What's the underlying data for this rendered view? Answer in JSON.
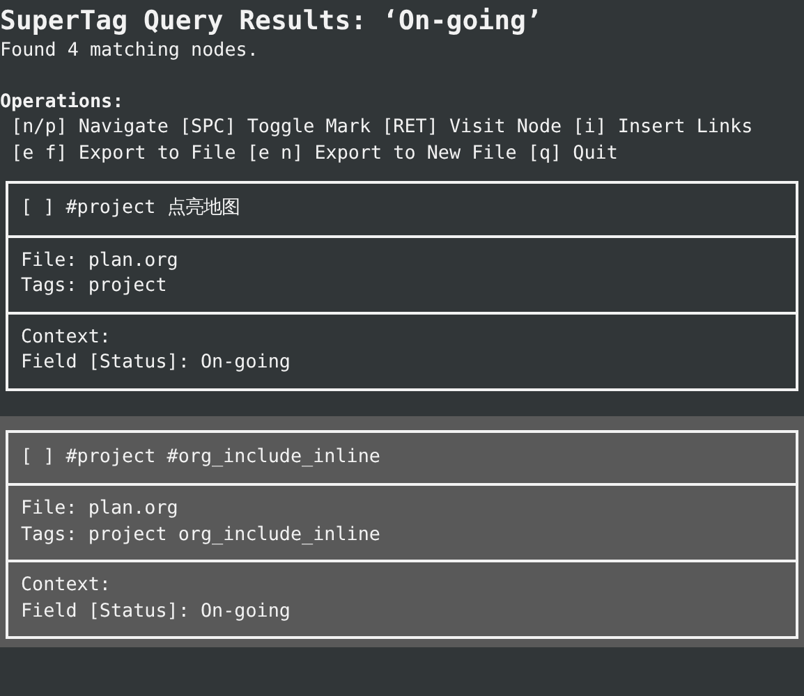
{
  "title": "SuperTag Query Results: ‘On-going’",
  "summary": "Found 4 matching nodes.",
  "operations": {
    "heading": "Operations:",
    "lines": [
      " [n/p] Navigate [SPC] Toggle Mark [RET] Visit Node [i] Insert Links",
      " [e f] Export to File [e n] Export to New File [q] Quit"
    ]
  },
  "nodes": [
    {
      "selected": false,
      "header": "[ ] #project 点亮地图",
      "file": "File: plan.org",
      "tags": "Tags: project",
      "context": "Context:",
      "field": "Field [Status]: On-going"
    },
    {
      "selected": true,
      "header": "[ ] #project #org_include_inline",
      "file": "File: plan.org",
      "tags": "Tags: project org_include_inline",
      "context": "Context:",
      "field": "Field [Status]: On-going"
    }
  ]
}
